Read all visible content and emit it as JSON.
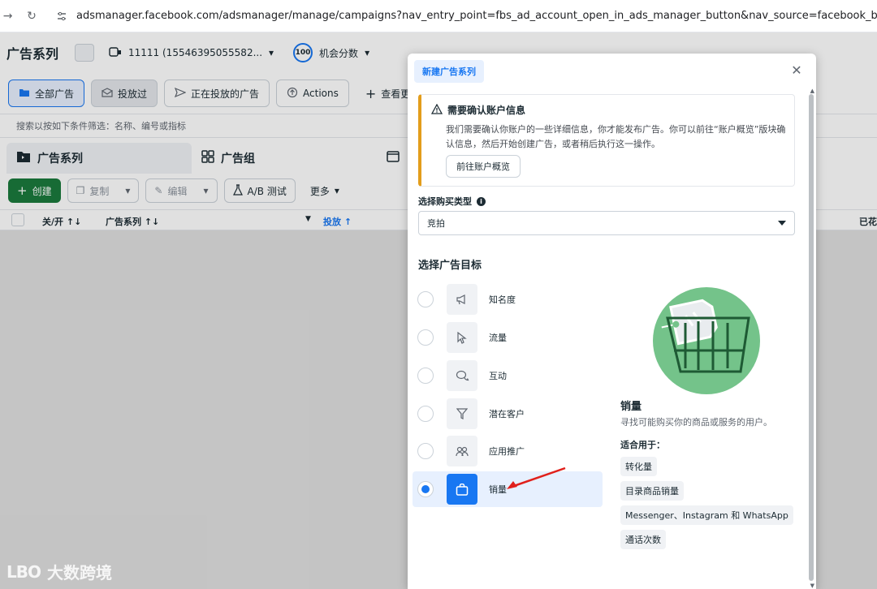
{
  "browser": {
    "url": "adsmanager.facebook.com/adsmanager/manage/campaigns?nav_entry_point=fbs_ad_account_open_in_ads_manager_button&nav_source=facebook_business_suite&tool=MANA"
  },
  "header": {
    "title": "广告系列",
    "account": "11111 (15546395055582...",
    "score_value": "100",
    "score_label": "机会分数"
  },
  "filters": [
    {
      "label": "全部广告"
    },
    {
      "label": "投放过"
    },
    {
      "label": "正在投放的广告"
    },
    {
      "label": "Actions"
    },
    {
      "label": "查看更多"
    }
  ],
  "search_hint": "搜索以按如下条件筛选：名称、编号或指标",
  "levels": [
    {
      "label": "广告系列"
    },
    {
      "label": "广告组"
    }
  ],
  "toolbar": {
    "create": "创建",
    "copy": "复制",
    "edit": "编辑",
    "ab_test": "A/B 测试",
    "more": "更多"
  },
  "table": {
    "columns": [
      "关/开 ↑↓",
      "广告系列 ↑↓",
      "投放 ↑",
      "已花"
    ]
  },
  "modal": {
    "tab": "新建广告系列",
    "alert": {
      "title": "需要确认账户信息",
      "body": "我们需要确认你账户的一些详细信息，你才能发布广告。你可以前往“账户概览”版块确认信息，然后开始创建广告，或者稍后执行这一操作。",
      "button": "前往账户概览"
    },
    "buy_type_label": "选择购买类型",
    "buy_type_value": "竞拍",
    "objective_title": "选择广告目标",
    "objectives": [
      {
        "label": "知名度",
        "icon": "megaphone-icon"
      },
      {
        "label": "流量",
        "icon": "cursor-icon"
      },
      {
        "label": "互动",
        "icon": "chat-bubbles-icon"
      },
      {
        "label": "潜在客户",
        "icon": "funnel-icon"
      },
      {
        "label": "应用推广",
        "icon": "people-icon"
      },
      {
        "label": "销量",
        "icon": "shopping-bag-icon"
      }
    ],
    "selected_objective": "销量",
    "detail": {
      "title": "销量",
      "desc": "寻找可能购买你的商品或服务的用户。",
      "fit_title": "适合用于：",
      "chips": [
        "转化量",
        "目录商品销量",
        "Messenger、Instagram 和 WhatsApp",
        "通话次数"
      ]
    }
  },
  "watermark": {
    "logo": "LBO",
    "text": "大数跨境"
  },
  "colors": {
    "accent": "#1877f2",
    "create_green": "#1b7a3d",
    "warning": "#e39d1c",
    "illustration_green": "#74c38a"
  }
}
